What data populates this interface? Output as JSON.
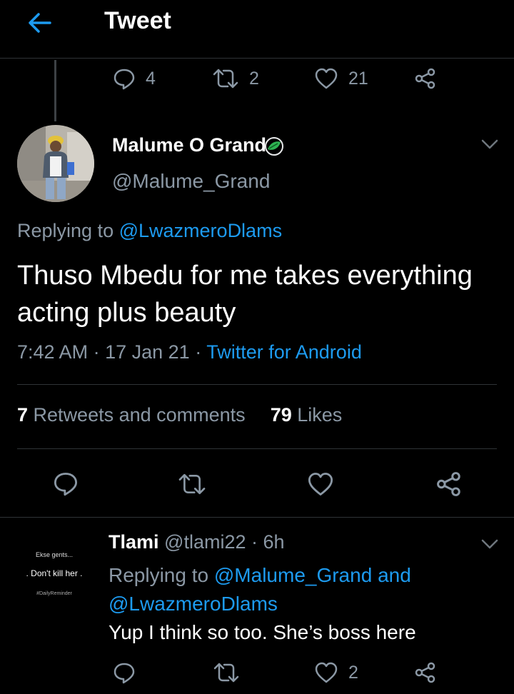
{
  "header": {
    "title": "Tweet"
  },
  "parent_actions": {
    "replies": "4",
    "retweets": "2",
    "likes": "21"
  },
  "tweet": {
    "name": "Malume O Grand",
    "handle": "@Malume_Grand",
    "replying_prefix": "Replying to",
    "replying_to": "@LwazmeroDlams",
    "text": "Thuso Mbedu for me takes everything acting plus beauty",
    "time": "7:42 AM",
    "date": "17 Jan 21",
    "source": "Twitter for Android",
    "retweets_count": "7",
    "retweets_label": "Retweets and comments",
    "likes_count": "79",
    "likes_label": "Likes"
  },
  "reply": {
    "name": "Tlami",
    "handle": "@tlami22",
    "time": "6h",
    "replying_prefix": "Replying to",
    "replying_to_1": "@Malume_Grand",
    "and_label": "and",
    "replying_to_2": "@LwazmeroDlams",
    "text": "Yup I think so too. She’s boss here",
    "likes": "2",
    "avatar_text": {
      "line1": "Ekse gents...",
      "line2": ". Don't kill her .",
      "line3": "#DailyReminder"
    }
  },
  "colors": {
    "background": "#000000",
    "accent": "#1d9bf0",
    "muted": "#8b98a5",
    "text": "#e7e9ea",
    "divider": "#2f3336"
  },
  "icons": [
    "back-arrow-icon",
    "reply-icon",
    "retweet-icon",
    "heart-icon",
    "share-icon",
    "chevron-down-icon",
    "verified-leaf-icon"
  ]
}
